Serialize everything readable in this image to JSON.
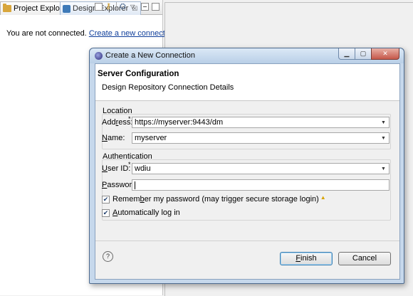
{
  "workbench": {
    "tabs": [
      {
        "label": "Project Explorer"
      },
      {
        "label": "Design Explorer",
        "close": "☒"
      }
    ],
    "message": "You are not connected.",
    "link": "Create a new connection."
  },
  "dialog": {
    "title": "Create a New Connection",
    "banner_title": "Server Configuration",
    "banner_desc": "Design Repository Connection Details",
    "location": {
      "group": "Location",
      "address_label": [
        "Add",
        "r",
        "ess:"
      ],
      "address_value": "https://myserver:9443/dm",
      "name_label": [
        "",
        "N",
        "ame:"
      ],
      "name_value": "myserver"
    },
    "authentication": {
      "group": "Authentication",
      "user_label": [
        "",
        "U",
        "ser ID:"
      ],
      "user_value": "wdiu",
      "password_label": [
        "",
        "P",
        "assword:"
      ],
      "password_value": ""
    },
    "remember": {
      "pre": "Remem",
      "u": "b",
      "post": "er my password (may trigger secure storage login)",
      "checked": true
    },
    "autologin": {
      "pre": "",
      "u": "A",
      "post": "utomatically log in",
      "checked": true
    },
    "finish": {
      "pre": "",
      "u": "F",
      "post": "inish"
    },
    "cancel": "Cancel",
    "help": "?",
    "check_mark": "✔",
    "required_mark": "*"
  }
}
